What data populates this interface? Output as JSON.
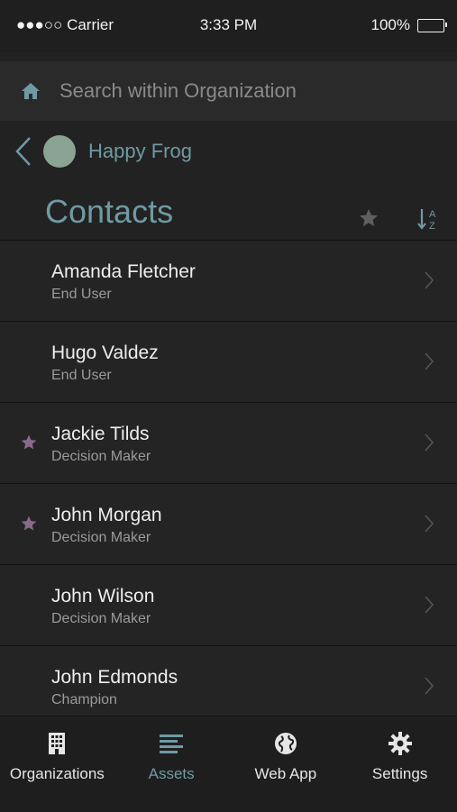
{
  "status_bar": {
    "carrier": "●●●○○ Carrier",
    "time": "3:33 PM",
    "battery": "100%"
  },
  "search": {
    "placeholder": "Search within Organization"
  },
  "organization": {
    "name": "Happy Frog"
  },
  "page": {
    "title": "Contacts"
  },
  "contacts": [
    {
      "name": "Amanda Fletcher",
      "role": "End User",
      "favorite": false
    },
    {
      "name": "Hugo Valdez",
      "role": "End User",
      "favorite": false
    },
    {
      "name": "Jackie Tilds",
      "role": "Decision Maker",
      "favorite": true
    },
    {
      "name": "John Morgan",
      "role": "Decision Maker",
      "favorite": true
    },
    {
      "name": "John Wilson",
      "role": "Decision Maker",
      "favorite": false
    },
    {
      "name": "John Edmonds",
      "role": "Champion",
      "favorite": false
    }
  ],
  "tabs": [
    {
      "label": "Organizations",
      "icon": "building-icon",
      "active": false
    },
    {
      "label": "Assets",
      "icon": "list-icon",
      "active": true
    },
    {
      "label": "Web App",
      "icon": "globe-icon",
      "active": false
    },
    {
      "label": "Settings",
      "icon": "gear-icon",
      "active": false
    }
  ],
  "colors": {
    "accent": "#6f9aa3",
    "favorite": "#8a6a8a",
    "background": "#222222"
  }
}
